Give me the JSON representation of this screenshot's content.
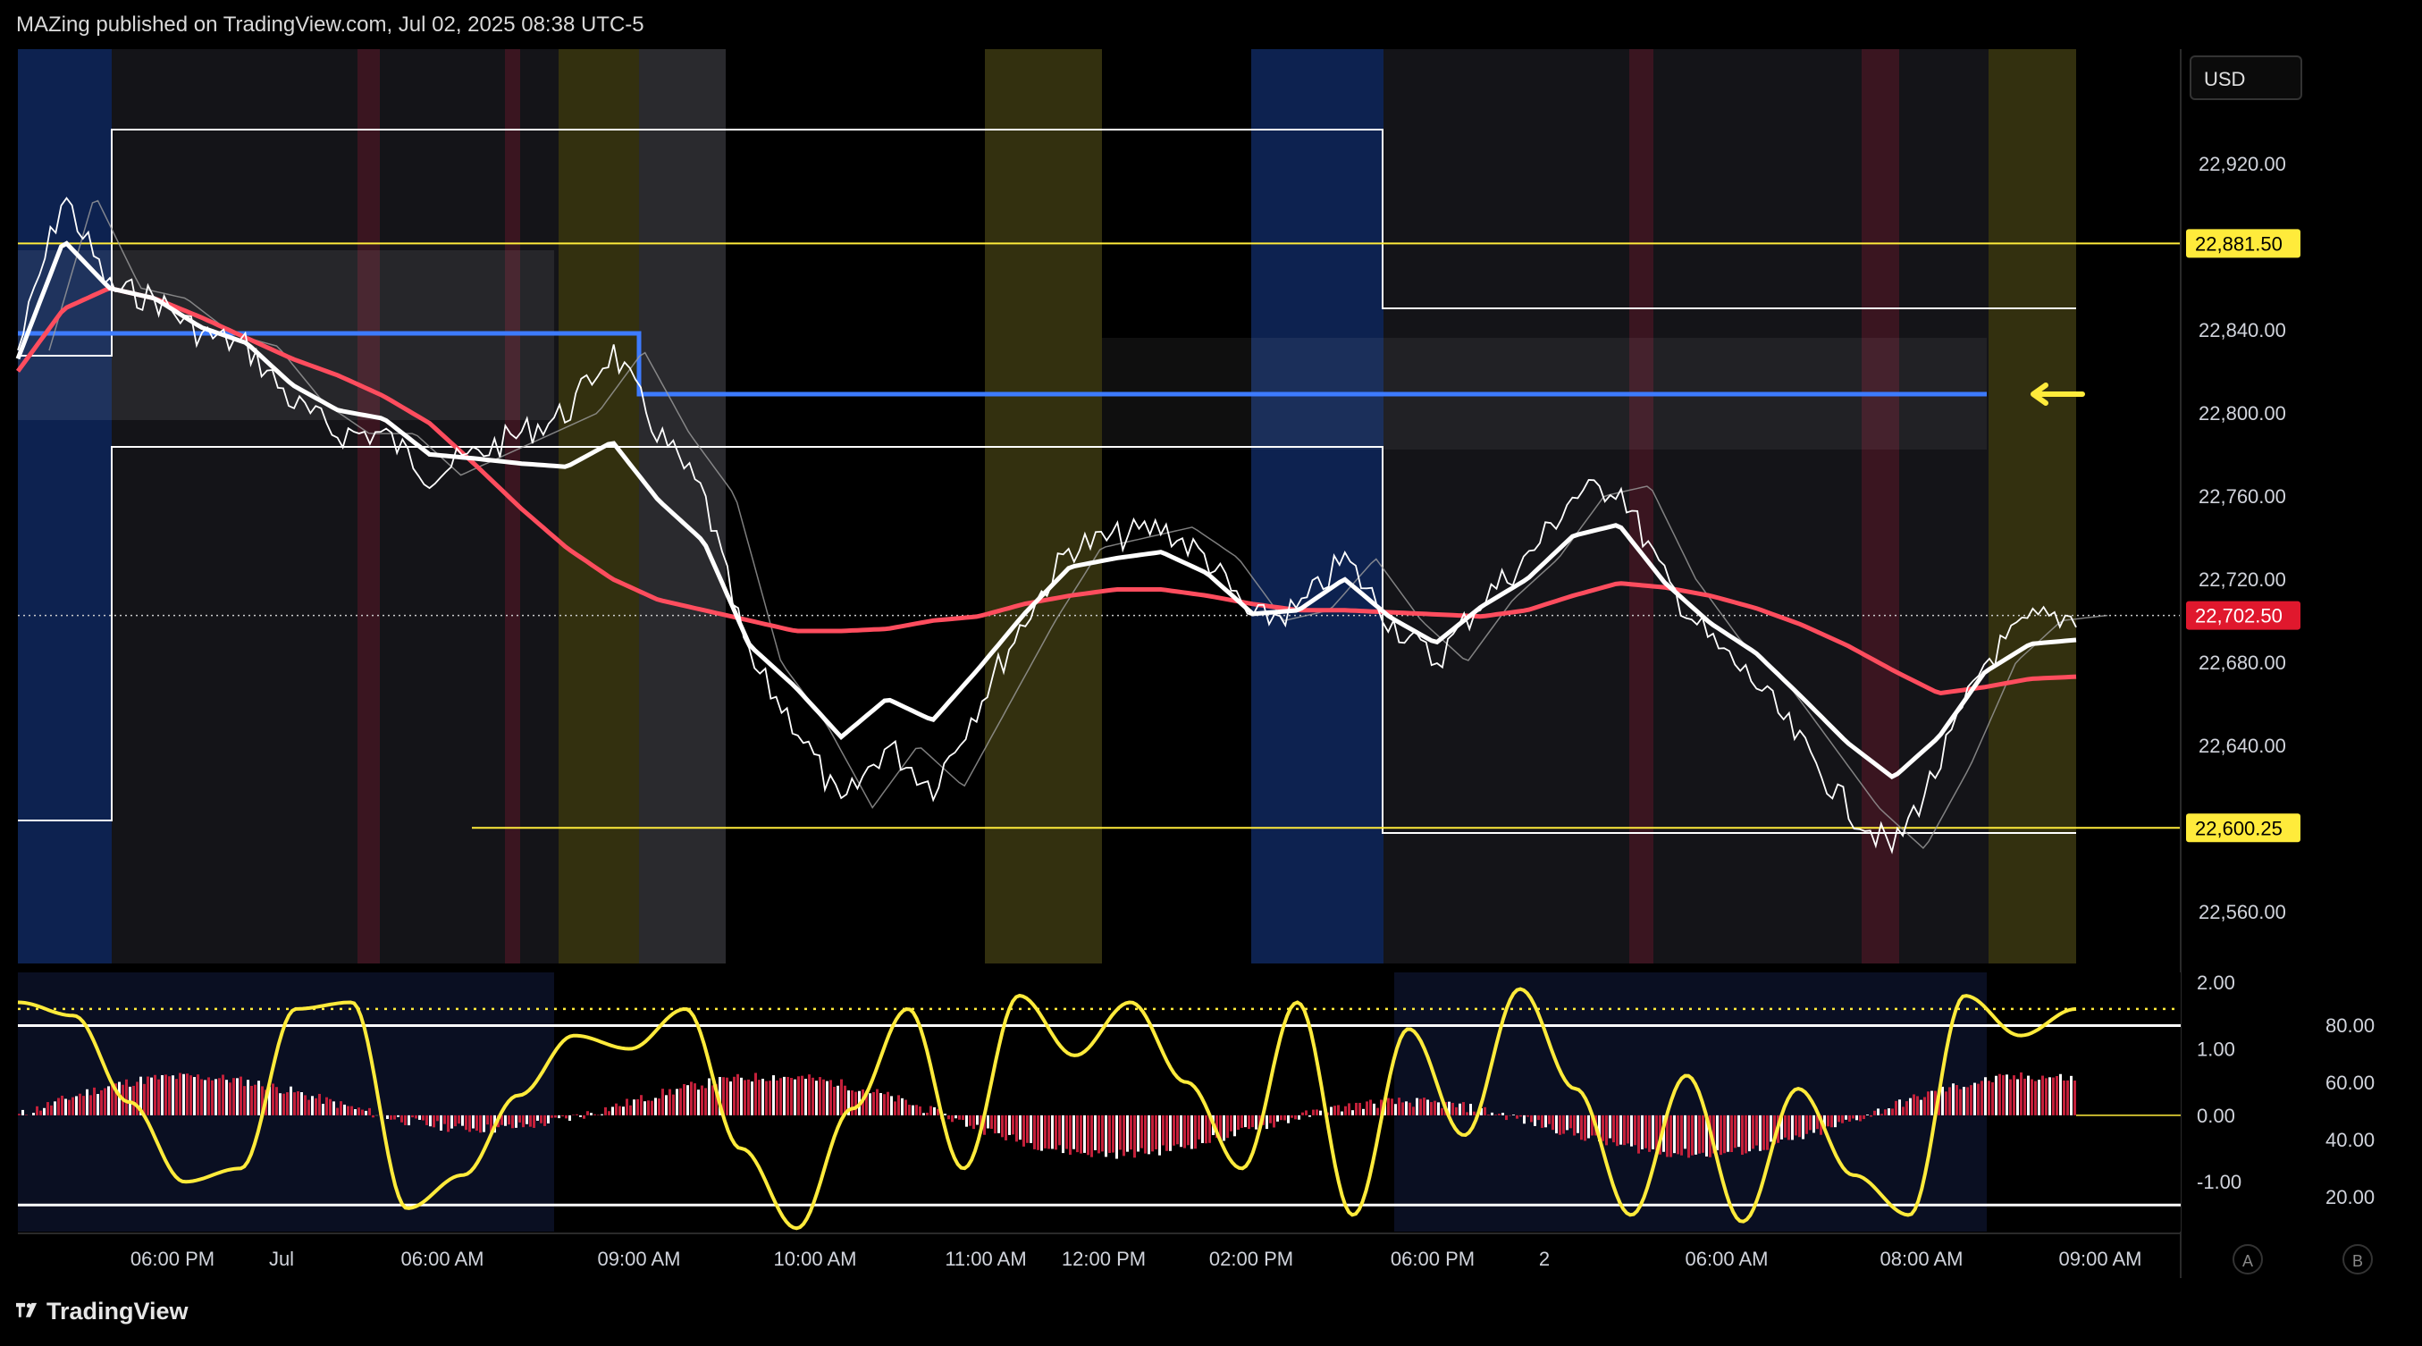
{
  "header": {
    "publisher": "MAZing published on TradingView.com, Jul 02, 2025 08:38 UTC-5"
  },
  "currency_button": {
    "label": "USD"
  },
  "footer": {
    "brand": "TradingView"
  },
  "bottom_buttons": {
    "a": "A",
    "b": "B"
  },
  "chart_data": [
    {
      "type": "line",
      "title": "",
      "series": [
        {
          "name": "",
          "color": "#ffffff",
          "values": [
            22830,
            22905,
            22860,
            22855,
            22838,
            22832,
            22805,
            22790,
            22790,
            22770,
            22780,
            22790,
            22800,
            22830,
            22790,
            22760,
            22680,
            22650,
            22610,
            22640,
            22620,
            22660,
            22700,
            22735,
            22740,
            22745,
            22730,
            22700,
            22705,
            22730,
            22700,
            22680,
            22710,
            22730,
            22760,
            22765,
            22720,
            22690,
            22670,
            22640,
            22610,
            22590,
            22630,
            22680,
            22700,
            22702.5
          ]
        },
        {
          "name": "",
          "color": "#ff4d5e",
          "values": [
            22820,
            22850,
            22860,
            22855,
            22846,
            22836,
            22826,
            22818,
            22808,
            22795,
            22775,
            22754,
            22735,
            22720,
            22710,
            22705,
            22700,
            22695,
            22695,
            22696,
            22700,
            22702,
            22708,
            22712,
            22715,
            22715,
            22712,
            22708,
            22705,
            22705,
            22704,
            22703,
            22702,
            22705,
            22712,
            22718,
            22716,
            22712,
            22706,
            22698,
            22688,
            22676,
            22665,
            22668,
            22672,
            22673
          ]
        }
      ],
      "y_axis_ticks": [
        "22,920.00",
        "22,840.00",
        "22,800.00",
        "22,760.00",
        "22,720.00",
        "22,680.00",
        "22,640.00",
        "22,560.00"
      ],
      "ylim": [
        22535,
        22975
      ],
      "price_labels": [
        {
          "label": "22,881.50",
          "value": 22881.5,
          "color": "#ffeb3b"
        },
        {
          "label": "22,702.50",
          "value": 22702.5,
          "color": "#e0182d"
        },
        {
          "label": "22,600.25",
          "value": 22600.25,
          "color": "#ffeb3b"
        }
      ],
      "blue_level": 22806,
      "x_axis_labels": [
        "06:00 PM",
        "Jul",
        "06:00 AM",
        "09:00 AM",
        "10:00 AM",
        "11:00 AM",
        "12:00 PM",
        "02:00 PM",
        "06:00 PM",
        "2",
        "06:00 AM",
        "08:00 AM",
        "09:00 AM"
      ],
      "grid": false,
      "legend": "none"
    },
    {
      "type": "line",
      "title": "",
      "y_axis_ticks_left": [
        "2.00",
        "1.00",
        "0.00",
        "-1.00"
      ],
      "y_axis_ticks_right": [
        "80.00",
        "60.00",
        "40.00",
        "20.00"
      ],
      "ylim": [
        -1.75,
        2.15
      ],
      "series": [
        {
          "name": "",
          "color": "#ffeb3b",
          "values": [
            1.7,
            1.5,
            0.2,
            -1.0,
            -0.8,
            1.6,
            1.7,
            -1.4,
            -0.9,
            0.3,
            1.2,
            1.0,
            1.6,
            -0.5,
            -1.7,
            0.1,
            1.6,
            -0.8,
            1.8,
            0.9,
            1.7,
            0.5,
            -0.8,
            1.7,
            -1.5,
            1.3,
            -0.3,
            1.9,
            0.4,
            -1.5,
            0.6,
            -1.6,
            0.4,
            -0.9,
            -1.5,
            1.8,
            1.2,
            1.6
          ]
        }
      ],
      "histogram_note": ""
    }
  ]
}
